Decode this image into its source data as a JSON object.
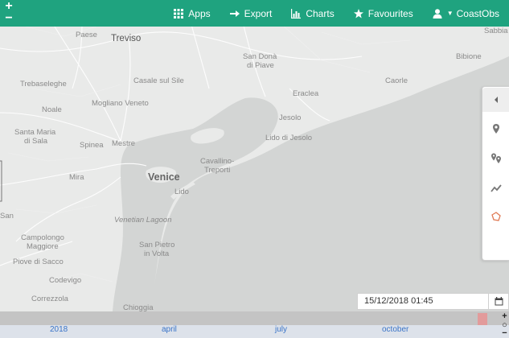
{
  "map": {
    "zoom_in": "+",
    "zoom_out": "−",
    "labels": {
      "paese": "Paese",
      "treviso": "Treviso",
      "san_dona": "San Donà",
      "di_piave": "di Piave",
      "sabbia": "Sabbia",
      "bibione": "Bibione",
      "trebaseleghe": "Trebaseleghe",
      "casale": "Casale sul Sile",
      "caorle": "Caorle",
      "eraclea": "Eraclea",
      "noale": "Noale",
      "mogliano": "Mogliano Veneto",
      "jesolo": "Jesolo",
      "santa_maria": "Santa Maria",
      "di_sala": "di Sala",
      "spinea": "Spinea",
      "mestre": "Mestre",
      "lido_jesolo": "Lido di Jesolo",
      "venice": "Venice",
      "cavallino": "Cavallino-",
      "treporti": "Treporti",
      "mira": "Mira",
      "lido": "Lido",
      "san": "San",
      "venetian_lagoon": "Venetian Lagoon",
      "campolongo": "Campolongo",
      "maggiore": "Maggiore",
      "san_pietro": "San Pietro",
      "in_volta": "in Volta",
      "piove": "Piove di Sacco",
      "codevigo": "Codevigo",
      "correzzola": "Correzzola",
      "chioggia": "Chioggia"
    }
  },
  "nav": {
    "apps": "Apps",
    "export": "Export",
    "charts": "Charts",
    "favourites": "Favourites",
    "user": "CoastObs"
  },
  "icons": {
    "apps": "grid-icon",
    "export": "export-arrow-icon",
    "charts": "bar-chart-icon",
    "favourites": "star-icon",
    "user": "user-icon",
    "panel": [
      "collapse-arrow-icon",
      "map-marker-icon",
      "multi-marker-icon",
      "line-chart-icon",
      "polygon-icon"
    ],
    "calendar": "calendar-icon"
  },
  "datetime": {
    "value": "15/12/2018 01:45"
  },
  "timeline": {
    "labels": [
      "2018",
      "april",
      "july",
      "october"
    ],
    "zoom_in": "+",
    "reset": "○",
    "zoom_out": "−"
  },
  "colors": {
    "header": "#1fa37f",
    "land": "#e9eae9",
    "water": "#d3d5d4",
    "timeline_link": "#3a74c8",
    "polygon_icon": "#e07a55"
  }
}
